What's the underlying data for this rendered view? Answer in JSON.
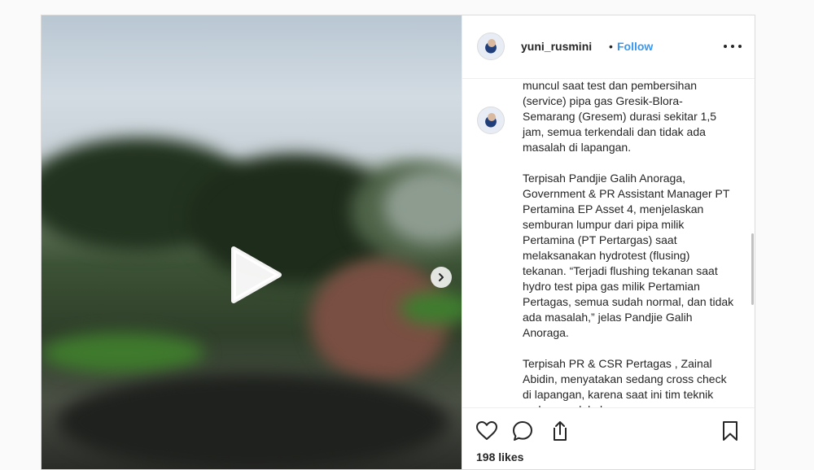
{
  "post": {
    "username": "yuni_rusmini",
    "separator": "•",
    "follow_label": "Follow",
    "more_icon": "more-options-icon",
    "caption": "muncul saat test dan pembersihan (service) pipa gas Gresik-Blora-Semarang (Gresem) durasi sekitar 1,5 jam, semua terkendali dan tidak ada masalah di lapangan.\n\nTerpisah Pandjie Galih Anoraga, Government & PR Assistant Manager PT Pertamina EP Asset 4, menjelaskan semburan lumpur dari pipa milik Pertamina (PT Pertargas) saat melaksanakan hydrotest (flusing) tekanan. “Terjadi flushing tekanan saat hydro test pipa gas milik Pertamian Pertagas, semua sudah normal, dan tidak ada masalah,” jelas Pandjie Galih Anoraga.\n\nTerpisah PR & CSR Pertagas , Zainal Abidin, menyatakan sedang cross check di lapangan, karena saat ini tim teknik sedang melakukan",
    "likes": "198 likes"
  },
  "media": {
    "type": "video",
    "play_icon": "play-icon",
    "next_icon": "chevron-right-icon"
  },
  "actions": {
    "like_icon": "heart-icon",
    "comment_icon": "comment-icon",
    "share_icon": "share-icon",
    "save_icon": "bookmark-icon"
  },
  "colors": {
    "follow": "#3897f0",
    "text": "#262626",
    "border": "#dbdbdb",
    "background": "#fafafa"
  }
}
